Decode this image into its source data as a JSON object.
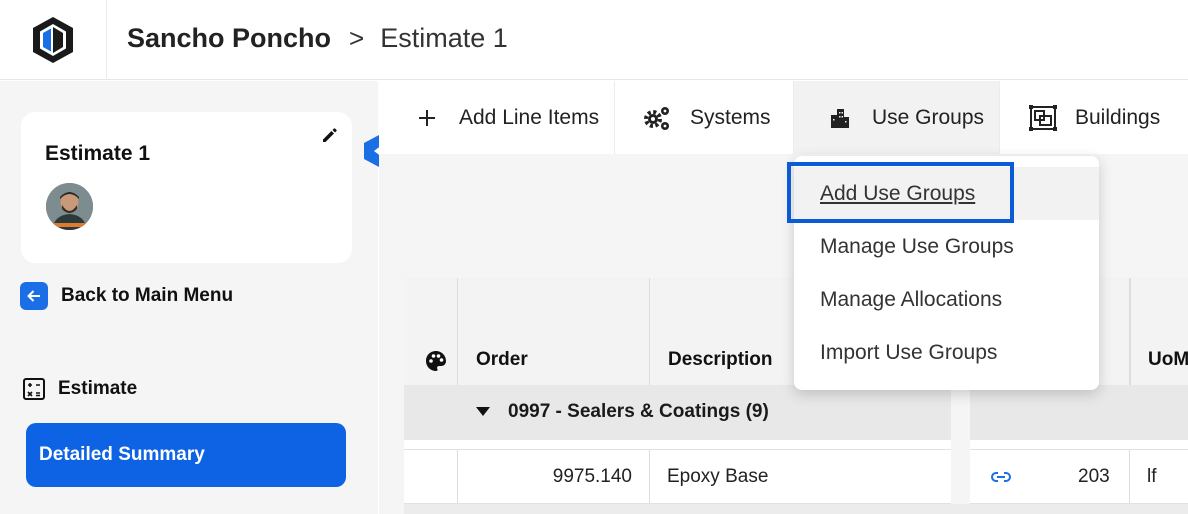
{
  "header": {
    "project": "Sancho Poncho",
    "separator": ">",
    "estimate": "Estimate 1",
    "logo_icon": "app-logo-icon"
  },
  "sidebar": {
    "card_title": "Estimate 1",
    "back_label": "Back to Main Menu",
    "section_label": "Estimate",
    "active_item": "Detailed Summary"
  },
  "toolbar": {
    "items": [
      {
        "label": "Add Line Items",
        "icon": "plus-icon"
      },
      {
        "label": "Systems",
        "icon": "gears-icon"
      },
      {
        "label": "Use Groups",
        "icon": "buildings-icon"
      },
      {
        "label": "Buildings",
        "icon": "floorplan-icon"
      }
    ]
  },
  "dropdown": {
    "items": [
      "Add Use Groups",
      "Manage Use Groups",
      "Manage Allocations",
      "Import Use Groups"
    ]
  },
  "table": {
    "columns": [
      "Order",
      "Description",
      "UoM"
    ],
    "group": "0997 - Sealers & Coatings (9)",
    "row": {
      "order": "9975.140",
      "description": "Epoxy Base",
      "qty": "203",
      "uom": "lf"
    }
  },
  "colors": {
    "accent": "#0d63e3",
    "highlight": "#0b5bd9"
  }
}
